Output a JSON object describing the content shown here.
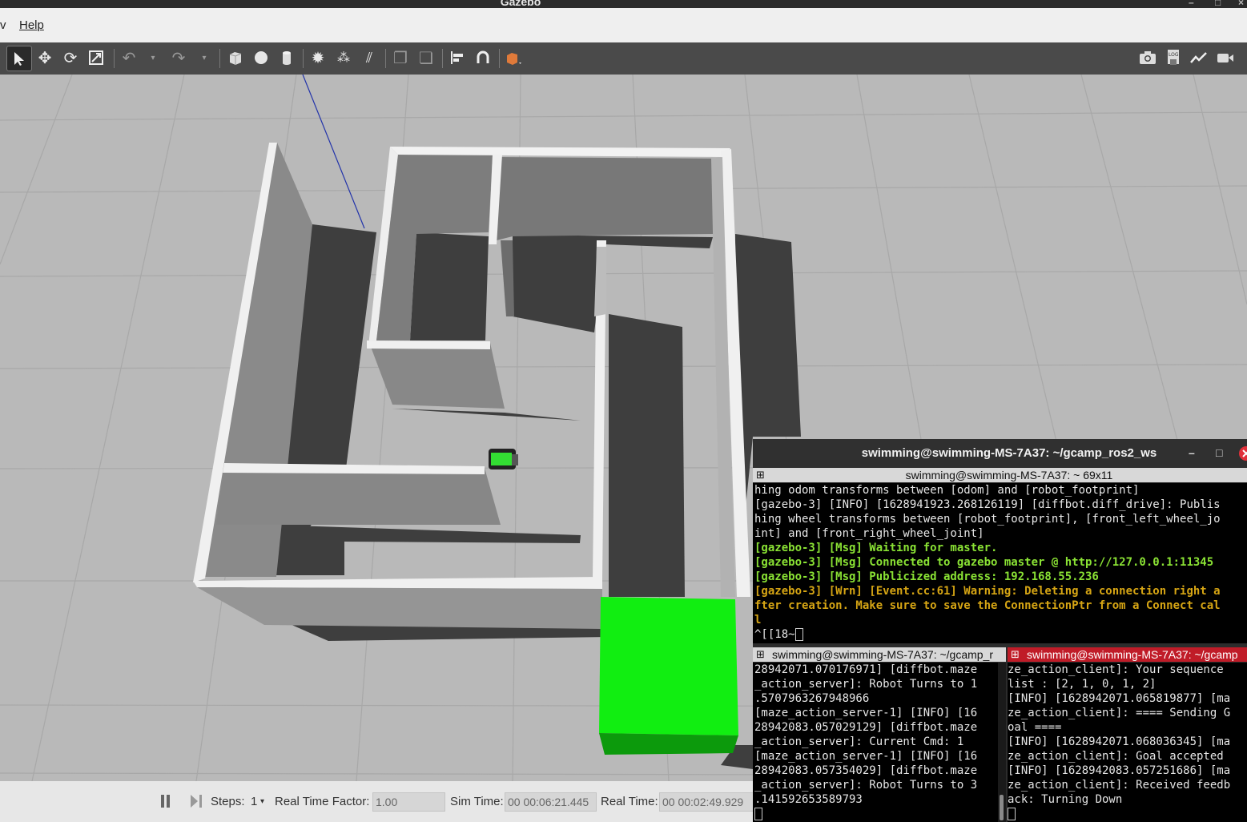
{
  "window": {
    "title": "Gazebo"
  },
  "menu": {
    "view_partial": "v",
    "help": "Help"
  },
  "toolbar": {
    "left_tools": [
      "select-arrow-icon",
      "translate-icon",
      "rotate-icon",
      "scale-icon",
      "undo-icon",
      "undo-dropdown-icon",
      "redo-icon",
      "redo-dropdown-icon",
      "box-icon",
      "sphere-icon",
      "cylinder-icon",
      "point-light-icon",
      "spot-light-icon",
      "directional-light-icon",
      "copy-icon",
      "paste-icon",
      "align-icon",
      "snap-icon",
      "view-angle-icon"
    ],
    "right_tools": [
      "screenshot-icon",
      "log-icon",
      "plot-icon",
      "record-video-icon"
    ]
  },
  "bottom_bar": {
    "steps_label": "Steps:",
    "steps_value": "1",
    "rtf_label": "Real Time Factor:",
    "rtf_value": "1.00",
    "sim_time_label": "Sim Time:",
    "sim_time_value": "00 00:06:21.445",
    "real_time_label": "Real Time:",
    "real_time_value": "00 00:02:49.929"
  },
  "terminal": {
    "title": "swimming@swimming-MS-7A37: ~/gcamp_ros2_ws",
    "top_pane": {
      "title": "swimming@swimming-MS-7A37: ~ 69x11",
      "lines": [
        {
          "text": "hing odom transforms between [odom] and [robot_footprint]",
          "style": ""
        },
        {
          "text": "[gazebo-3] [INFO] [1628941923.268126119] [diffbot.diff_drive]: Publis",
          "style": ""
        },
        {
          "text": "hing wheel transforms between [robot_footprint], [front_left_wheel_jo",
          "style": ""
        },
        {
          "text": "int] and [front_right_wheel_joint]",
          "style": ""
        },
        {
          "text": "[gazebo-3] [Msg] Waiting for master.",
          "style": "g"
        },
        {
          "text": "[gazebo-3] [Msg] Connected to gazebo master @ http://127.0.0.1:11345",
          "style": "g"
        },
        {
          "text": "[gazebo-3] [Msg] Publicized address: 192.168.55.236",
          "style": "g"
        },
        {
          "text": "[gazebo-3] [Wrn] [Event.cc:61] Warning: Deleting a connection right a",
          "style": "y"
        },
        {
          "text": "fter creation. Make sure to save the ConnectionPtr from a Connect cal",
          "style": "y"
        },
        {
          "text": "l",
          "style": "y"
        },
        {
          "text": "^[[18~",
          "style": ""
        }
      ]
    },
    "left_pane": {
      "title": "swimming@swimming-MS-7A37: ~/gcamp_r",
      "lines": [
        "28942071.070176971] [diffbot.maze",
        "_action_server]: Robot Turns to 1",
        ".5707963267948966",
        "[maze_action_server-1] [INFO] [16",
        "28942083.057029129] [diffbot.maze",
        "_action_server]: Current Cmd: 1",
        "[maze_action_server-1] [INFO] [16",
        "28942083.057354029] [diffbot.maze",
        "_action_server]: Robot Turns to 3",
        ".141592653589793"
      ]
    },
    "right_pane": {
      "title": "swimming@swimming-MS-7A37: ~/gcamp",
      "lines": [
        "ze_action_client]: Your sequence",
        "list : [2, 1, 0, 1, 2]",
        "[INFO] [1628942071.065819877] [ma",
        "ze_action_client]: ==== Sending G",
        "oal ====",
        "[INFO] [1628942071.068036345] [ma",
        "ze_action_client]: Goal accepted",
        "[INFO] [1628942083.057251686] [ma",
        "ze_action_client]: Received feedb",
        "ack: Turning Down"
      ]
    }
  }
}
